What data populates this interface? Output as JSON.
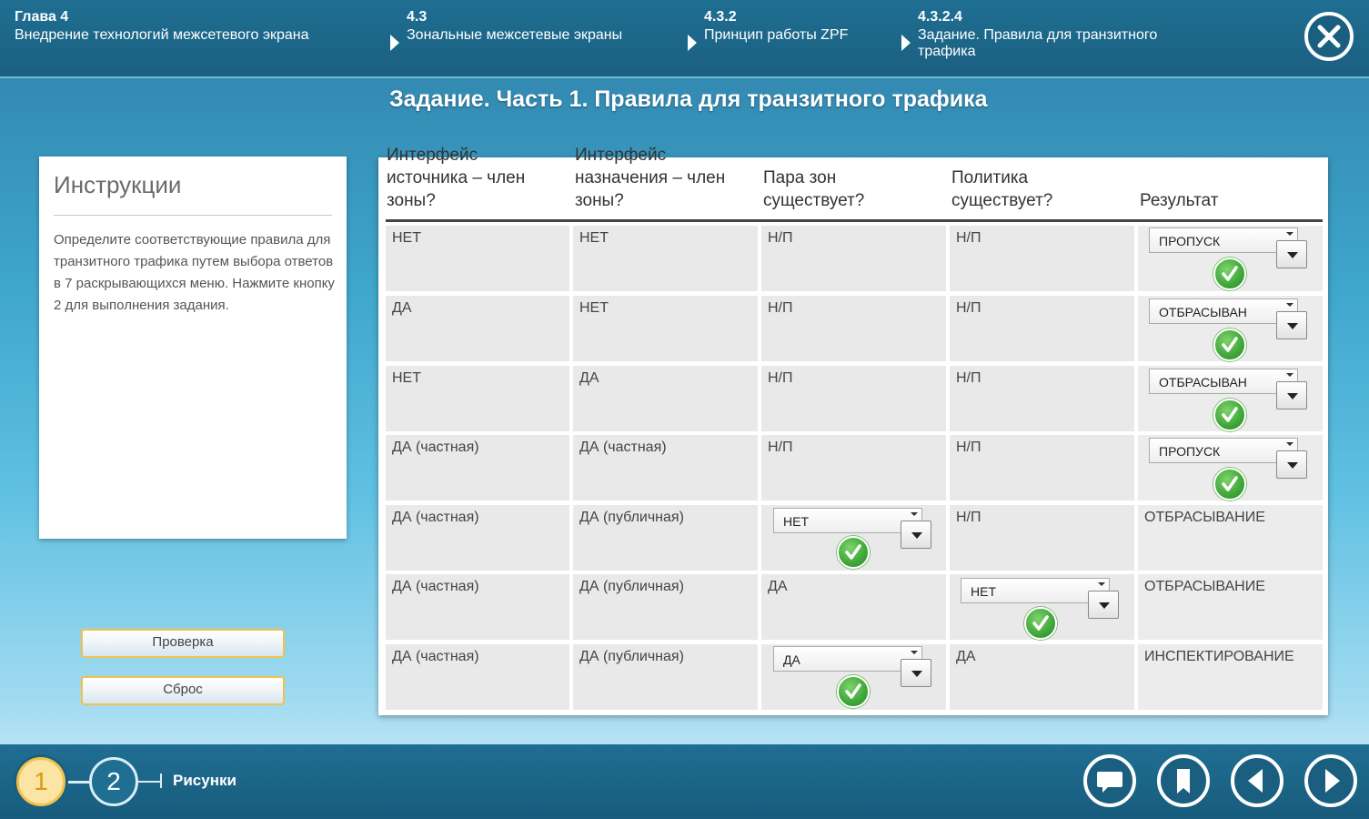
{
  "breadcrumbs": [
    {
      "num": "Глава 4",
      "text": "Внедрение технологий межсетевого экрана"
    },
    {
      "num": "4.3",
      "text": "Зональные межсетевые экраны"
    },
    {
      "num": "4.3.2",
      "text": "Принцип работы ZPF"
    },
    {
      "num": "4.3.2.4",
      "text": "Задание. Правила для транзитного трафика"
    }
  ],
  "page_title": "Задание. Часть 1. Правила для транзитного трафика",
  "instructions": {
    "heading": "Инструкции",
    "body": "Определите соответствующие правила для транзитного трафика путем выбора ответов в 7 раскрывающихся меню. Нажмите кнопку 2 для выполнения задания."
  },
  "buttons": {
    "check": "Проверка",
    "reset": "Сброс"
  },
  "table": {
    "headers": [
      "Интерфейс источника – член зоны?",
      "Интерфейс назначения – член зоны?",
      "Пара зон существует?",
      "Политика существует?",
      "Результат"
    ],
    "rows": [
      [
        "НЕТ",
        "НЕТ",
        "Н/П",
        "Н/П",
        "ПРОПУСК"
      ],
      [
        "ДА",
        "НЕТ",
        "Н/П",
        "Н/П",
        "ОТБРАСЫВАН"
      ],
      [
        "НЕТ",
        "ДА",
        "Н/П",
        "Н/П",
        "ОТБРАСЫВАН"
      ],
      [
        "ДА (частная)",
        "ДА (частная)",
        "Н/П",
        "Н/П",
        "ПРОПУСК"
      ],
      [
        "ДА (частная)",
        "ДА (публичная)",
        "НЕТ",
        "Н/П",
        "ОТБРАСЫВАНИЕ"
      ],
      [
        "ДА (частная)",
        "ДА (публичная)",
        "ДА",
        "НЕТ",
        "ОТБРАСЫВАНИЕ"
      ],
      [
        "ДА (частная)",
        "ДА (публичная)",
        "ДА",
        "ДА",
        "ИНСПЕКТИРОВАНИЕ"
      ]
    ]
  },
  "footer": {
    "step1": "1",
    "step2": "2",
    "figures_label": "Рисунки"
  },
  "icons": {
    "close": "close-icon",
    "chat": "chat-icon",
    "bookmark": "bookmark-icon",
    "prev": "prev-arrow-icon",
    "next": "next-arrow-icon",
    "check": "check-icon"
  }
}
